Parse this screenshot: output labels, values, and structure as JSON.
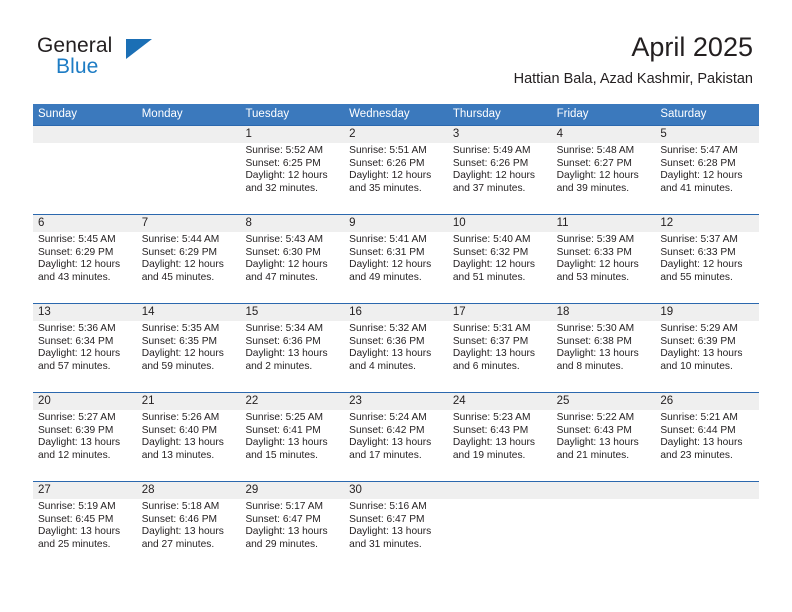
{
  "brand": {
    "word_one": "General",
    "word_two": "Blue",
    "triangle_icon": "triangle-icon"
  },
  "header": {
    "title": "April 2025",
    "subtitle": "Hattian Bala, Azad Kashmir, Pakistan"
  },
  "colors": {
    "header_blue": "#3b79bd",
    "row_border_blue": "#2b68ae",
    "brand_blue": "#1d7cc4",
    "day_band_gray": "#efefef",
    "text": "#231f20"
  },
  "weekdays": [
    "Sunday",
    "Monday",
    "Tuesday",
    "Wednesday",
    "Thursday",
    "Friday",
    "Saturday"
  ],
  "labels": {
    "sunrise_prefix": "Sunrise:",
    "sunset_prefix": "Sunset:",
    "daylight_prefix": "Daylight:"
  },
  "weeks": [
    [
      {
        "day": "",
        "empty": true
      },
      {
        "day": "",
        "empty": true
      },
      {
        "day": "1",
        "sunrise": "Sunrise: 5:52 AM",
        "sunset": "Sunset: 6:25 PM",
        "daylight_line1": "Daylight: 12 hours",
        "daylight_line2": "and 32 minutes."
      },
      {
        "day": "2",
        "sunrise": "Sunrise: 5:51 AM",
        "sunset": "Sunset: 6:26 PM",
        "daylight_line1": "Daylight: 12 hours",
        "daylight_line2": "and 35 minutes."
      },
      {
        "day": "3",
        "sunrise": "Sunrise: 5:49 AM",
        "sunset": "Sunset: 6:26 PM",
        "daylight_line1": "Daylight: 12 hours",
        "daylight_line2": "and 37 minutes."
      },
      {
        "day": "4",
        "sunrise": "Sunrise: 5:48 AM",
        "sunset": "Sunset: 6:27 PM",
        "daylight_line1": "Daylight: 12 hours",
        "daylight_line2": "and 39 minutes."
      },
      {
        "day": "5",
        "sunrise": "Sunrise: 5:47 AM",
        "sunset": "Sunset: 6:28 PM",
        "daylight_line1": "Daylight: 12 hours",
        "daylight_line2": "and 41 minutes."
      }
    ],
    [
      {
        "day": "6",
        "sunrise": "Sunrise: 5:45 AM",
        "sunset": "Sunset: 6:29 PM",
        "daylight_line1": "Daylight: 12 hours",
        "daylight_line2": "and 43 minutes."
      },
      {
        "day": "7",
        "sunrise": "Sunrise: 5:44 AM",
        "sunset": "Sunset: 6:29 PM",
        "daylight_line1": "Daylight: 12 hours",
        "daylight_line2": "and 45 minutes."
      },
      {
        "day": "8",
        "sunrise": "Sunrise: 5:43 AM",
        "sunset": "Sunset: 6:30 PM",
        "daylight_line1": "Daylight: 12 hours",
        "daylight_line2": "and 47 minutes."
      },
      {
        "day": "9",
        "sunrise": "Sunrise: 5:41 AM",
        "sunset": "Sunset: 6:31 PM",
        "daylight_line1": "Daylight: 12 hours",
        "daylight_line2": "and 49 minutes."
      },
      {
        "day": "10",
        "sunrise": "Sunrise: 5:40 AM",
        "sunset": "Sunset: 6:32 PM",
        "daylight_line1": "Daylight: 12 hours",
        "daylight_line2": "and 51 minutes."
      },
      {
        "day": "11",
        "sunrise": "Sunrise: 5:39 AM",
        "sunset": "Sunset: 6:33 PM",
        "daylight_line1": "Daylight: 12 hours",
        "daylight_line2": "and 53 minutes."
      },
      {
        "day": "12",
        "sunrise": "Sunrise: 5:37 AM",
        "sunset": "Sunset: 6:33 PM",
        "daylight_line1": "Daylight: 12 hours",
        "daylight_line2": "and 55 minutes."
      }
    ],
    [
      {
        "day": "13",
        "sunrise": "Sunrise: 5:36 AM",
        "sunset": "Sunset: 6:34 PM",
        "daylight_line1": "Daylight: 12 hours",
        "daylight_line2": "and 57 minutes."
      },
      {
        "day": "14",
        "sunrise": "Sunrise: 5:35 AM",
        "sunset": "Sunset: 6:35 PM",
        "daylight_line1": "Daylight: 12 hours",
        "daylight_line2": "and 59 minutes."
      },
      {
        "day": "15",
        "sunrise": "Sunrise: 5:34 AM",
        "sunset": "Sunset: 6:36 PM",
        "daylight_line1": "Daylight: 13 hours",
        "daylight_line2": "and 2 minutes."
      },
      {
        "day": "16",
        "sunrise": "Sunrise: 5:32 AM",
        "sunset": "Sunset: 6:36 PM",
        "daylight_line1": "Daylight: 13 hours",
        "daylight_line2": "and 4 minutes."
      },
      {
        "day": "17",
        "sunrise": "Sunrise: 5:31 AM",
        "sunset": "Sunset: 6:37 PM",
        "daylight_line1": "Daylight: 13 hours",
        "daylight_line2": "and 6 minutes."
      },
      {
        "day": "18",
        "sunrise": "Sunrise: 5:30 AM",
        "sunset": "Sunset: 6:38 PM",
        "daylight_line1": "Daylight: 13 hours",
        "daylight_line2": "and 8 minutes."
      },
      {
        "day": "19",
        "sunrise": "Sunrise: 5:29 AM",
        "sunset": "Sunset: 6:39 PM",
        "daylight_line1": "Daylight: 13 hours",
        "daylight_line2": "and 10 minutes."
      }
    ],
    [
      {
        "day": "20",
        "sunrise": "Sunrise: 5:27 AM",
        "sunset": "Sunset: 6:39 PM",
        "daylight_line1": "Daylight: 13 hours",
        "daylight_line2": "and 12 minutes."
      },
      {
        "day": "21",
        "sunrise": "Sunrise: 5:26 AM",
        "sunset": "Sunset: 6:40 PM",
        "daylight_line1": "Daylight: 13 hours",
        "daylight_line2": "and 13 minutes."
      },
      {
        "day": "22",
        "sunrise": "Sunrise: 5:25 AM",
        "sunset": "Sunset: 6:41 PM",
        "daylight_line1": "Daylight: 13 hours",
        "daylight_line2": "and 15 minutes."
      },
      {
        "day": "23",
        "sunrise": "Sunrise: 5:24 AM",
        "sunset": "Sunset: 6:42 PM",
        "daylight_line1": "Daylight: 13 hours",
        "daylight_line2": "and 17 minutes."
      },
      {
        "day": "24",
        "sunrise": "Sunrise: 5:23 AM",
        "sunset": "Sunset: 6:43 PM",
        "daylight_line1": "Daylight: 13 hours",
        "daylight_line2": "and 19 minutes."
      },
      {
        "day": "25",
        "sunrise": "Sunrise: 5:22 AM",
        "sunset": "Sunset: 6:43 PM",
        "daylight_line1": "Daylight: 13 hours",
        "daylight_line2": "and 21 minutes."
      },
      {
        "day": "26",
        "sunrise": "Sunrise: 5:21 AM",
        "sunset": "Sunset: 6:44 PM",
        "daylight_line1": "Daylight: 13 hours",
        "daylight_line2": "and 23 minutes."
      }
    ],
    [
      {
        "day": "27",
        "sunrise": "Sunrise: 5:19 AM",
        "sunset": "Sunset: 6:45 PM",
        "daylight_line1": "Daylight: 13 hours",
        "daylight_line2": "and 25 minutes."
      },
      {
        "day": "28",
        "sunrise": "Sunrise: 5:18 AM",
        "sunset": "Sunset: 6:46 PM",
        "daylight_line1": "Daylight: 13 hours",
        "daylight_line2": "and 27 minutes."
      },
      {
        "day": "29",
        "sunrise": "Sunrise: 5:17 AM",
        "sunset": "Sunset: 6:47 PM",
        "daylight_line1": "Daylight: 13 hours",
        "daylight_line2": "and 29 minutes."
      },
      {
        "day": "30",
        "sunrise": "Sunrise: 5:16 AM",
        "sunset": "Sunset: 6:47 PM",
        "daylight_line1": "Daylight: 13 hours",
        "daylight_line2": "and 31 minutes."
      },
      {
        "day": "",
        "empty": true
      },
      {
        "day": "",
        "empty": true
      },
      {
        "day": "",
        "empty": true
      }
    ]
  ]
}
